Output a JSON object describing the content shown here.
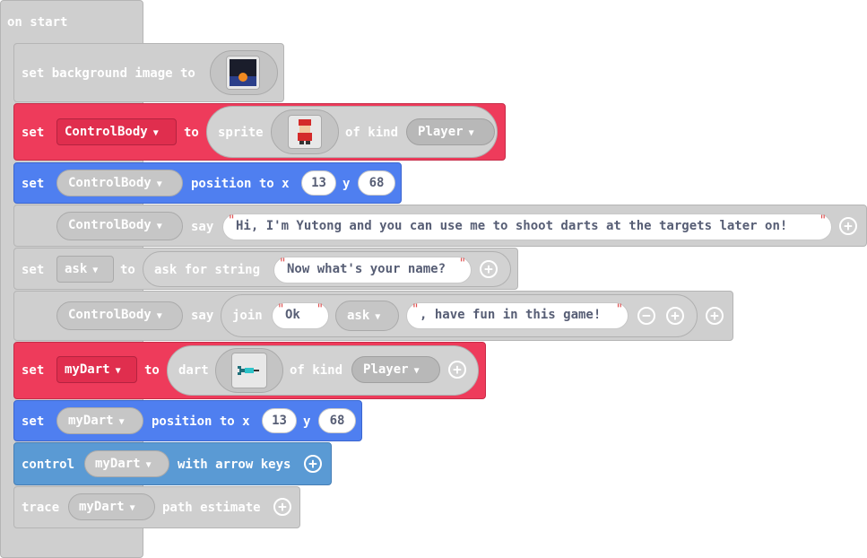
{
  "hat": {
    "label": "on start"
  },
  "b1": {
    "kw": "set background image to"
  },
  "b2": {
    "kw1": "set",
    "var": "ControlBody",
    "kw2": "to",
    "sprite": "sprite",
    "kind_kw": "of kind",
    "kind": "Player"
  },
  "b3": {
    "kw1": "set",
    "var": "ControlBody",
    "kw2": "position to x",
    "x": "13",
    "ykw": "y",
    "y": "68"
  },
  "b4": {
    "var": "ControlBody",
    "kw": "say",
    "text": "Hi, I'm Yutong and you can use me to shoot darts at the targets later on!"
  },
  "b5": {
    "kw1": "set",
    "var": "ask",
    "kw2": "to",
    "fn": "ask for string",
    "text": "Now what's your name?"
  },
  "b6": {
    "var": "ControlBody",
    "kw": "say",
    "join": "join",
    "s1": "Ok ",
    "var2": "ask",
    "s2": ", have fun in this game!"
  },
  "b7": {
    "kw1": "set",
    "var": "myDart",
    "kw2": "to",
    "sprite": "dart",
    "kind_kw": "of kind",
    "kind": "Player"
  },
  "b8": {
    "kw1": "set",
    "var": "myDart",
    "kw2": "position to x",
    "x": "13",
    "ykw": "y",
    "y": "68"
  },
  "b9": {
    "kw1": "control",
    "var": "myDart",
    "kw2": "with arrow keys"
  },
  "b10": {
    "kw1": "trace",
    "var": "myDart",
    "kw2": "path estimate"
  },
  "caret": "▼",
  "plus": "+",
  "minus": "−"
}
